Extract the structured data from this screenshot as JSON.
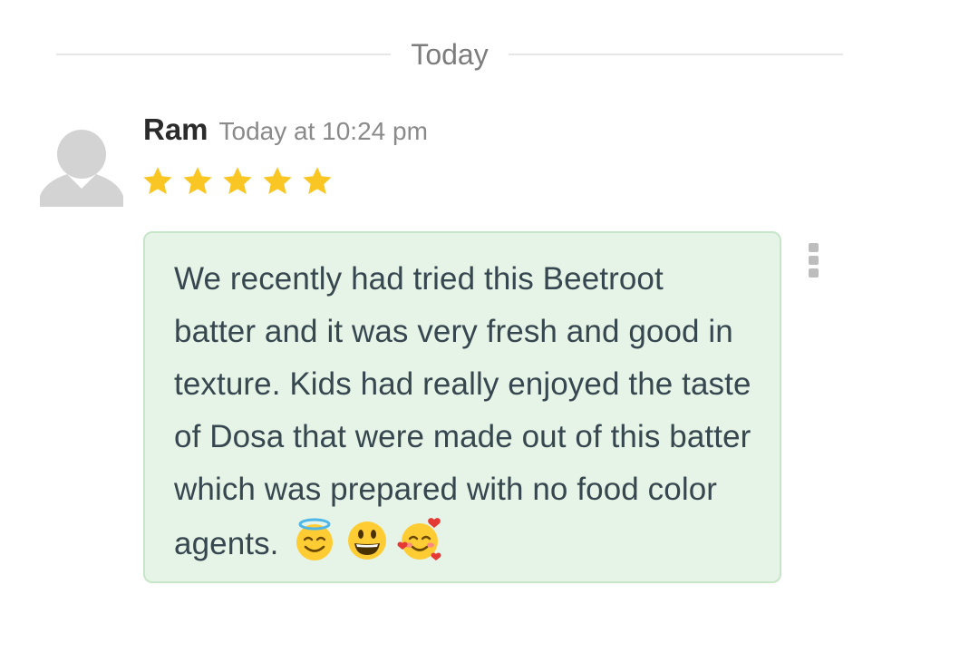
{
  "divider": {
    "label": "Today"
  },
  "review": {
    "author": "Ram",
    "timestamp": "Today at 10:24 pm",
    "rating": 5,
    "rating_max": 5,
    "message": "We recently had tried this Beetroot batter and it was very fresh and good in texture. Kids had really enjoyed the taste of Dosa that were made out of this batter which was prepared with no food color agents.",
    "emojis": [
      "smiling-face-with-halo-emoji",
      "grinning-face-emoji",
      "smiling-face-with-hearts-emoji"
    ]
  },
  "colors": {
    "bubble_bg": "#e6f4e7",
    "bubble_border": "#c7e5c9",
    "star": "#f9c623",
    "text": "#37474f"
  },
  "icons": {
    "avatar": "default-user-icon",
    "menu": "more-vertical-icon"
  }
}
